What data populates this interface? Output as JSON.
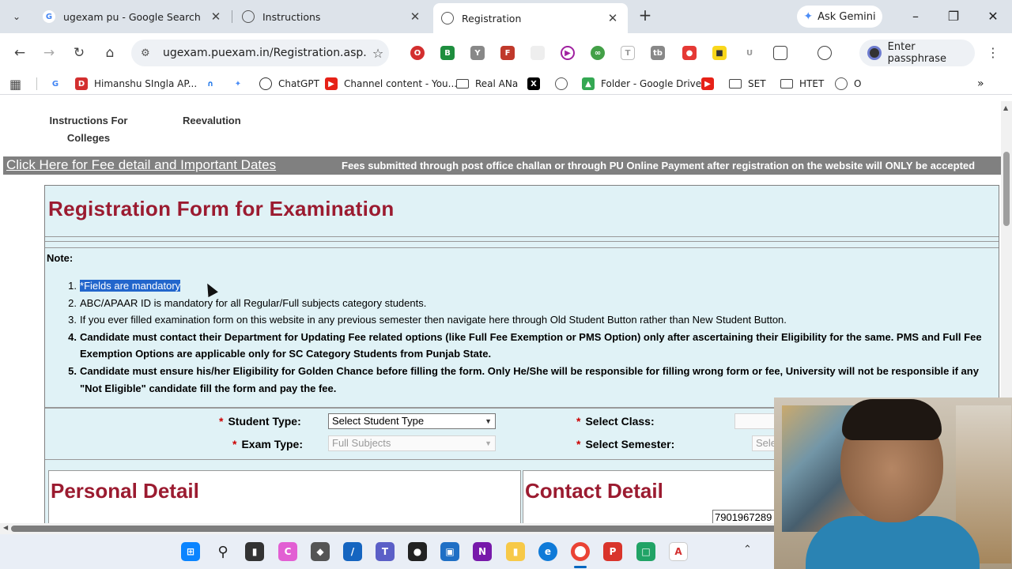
{
  "browser": {
    "tabs": [
      {
        "title": "ugexam pu - Google Search",
        "icon": "google-icon"
      },
      {
        "title": "Instructions",
        "icon": "globe-icon"
      },
      {
        "title": "Registration",
        "icon": "globe-icon",
        "active": true
      }
    ],
    "ask_gemini": "Ask Gemini",
    "url": "ugexam.puexam.in/Registration.asp...",
    "passphrase": "Enter passphrase",
    "bookmarks": [
      {
        "label": "Himanshu SIngla AP...",
        "icon": "pdf-icon"
      },
      {
        "label": "ChatGPT",
        "icon": "chatgpt-icon"
      },
      {
        "label": "Channel content - You...",
        "icon": "youtube-icon"
      },
      {
        "label": "Real ANa",
        "icon": "folder-icon"
      },
      {
        "label": "Folder - Google Drive",
        "icon": "drive-icon"
      },
      {
        "label": "SET",
        "icon": "folder-icon"
      },
      {
        "label": "HTET",
        "icon": "folder-icon"
      },
      {
        "label": "O",
        "icon": "globe-icon"
      }
    ]
  },
  "page": {
    "topnav": {
      "instructions": "Instructions For Colleges",
      "instructions_line1": "Instructions For",
      "instructions_line2": "Colleges",
      "reevaluation": "Reevalution"
    },
    "fee_link": "Click Here for Fee detail and Important Dates",
    "marquee": "Fees submitted through post office challan or through PU Online Payment after registration on the website will ONLY be accepted",
    "form_title": "Registration Form for Examination",
    "note_title": "Note:",
    "notes": {
      "n1_ast": "*",
      "n1": "Fields are mandatory",
      "n2": "ABC/APAAR ID is mandatory for all Regular/Full subjects category students.",
      "n3": "If you ever filled examination form on this website in any previous semester then navigate here through Old Student Button rather than New Student Button.",
      "n4": "Candidate must contact their Department for Updating Fee related options (like Full Fee Exemption or PMS Option) only after ascertaining their Eligibility for the same. PMS and Full Fee Exemption Options are applicable only for SC Category Students from Punjab State.",
      "n5": "Candidate must ensure his/her Eligibility for Golden Chance before filling the form. Only He/She will be responsible for filling wrong form or fee, University will not be responsible if any \"Not Eligible\" candidate fill the form and pay the fee."
    },
    "fields": {
      "required_mark": "*",
      "student_type_label": "Student Type:",
      "student_type_value": "Select Student Type",
      "exam_type_label": "Exam Type:",
      "exam_type_value": "Full Subjects",
      "class_label": "Select Class:",
      "semester_label": "Select Semester:",
      "semester_value": "Sele"
    },
    "personal_detail": "Personal Detail",
    "contact_detail": "Contact Detail",
    "phone_value": "7901967289"
  },
  "colors": {
    "title_red": "#9b1b30",
    "form_bg": "#e0f2f6",
    "marquee_bg": "#808080",
    "highlight": "#2266cc"
  }
}
